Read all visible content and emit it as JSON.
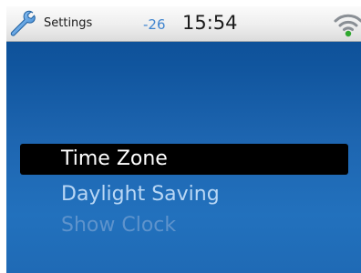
{
  "status_bar": {
    "app_icon": "wrench-icon",
    "app_title": "Settings",
    "signal_value": "-26",
    "time": "15:54",
    "wifi_icon": "wifi-icon"
  },
  "menu": {
    "items": [
      {
        "label": "Time Zone",
        "state": "selected"
      },
      {
        "label": "Daylight Saving",
        "state": "normal"
      },
      {
        "label": "Show Clock",
        "state": "disabled"
      }
    ]
  },
  "colors": {
    "background_top": "#0b4c93",
    "background_bottom": "#2271bd",
    "selection": "#000000",
    "signal_text": "#3f84cf",
    "wifi_green": "#2fa82f"
  }
}
